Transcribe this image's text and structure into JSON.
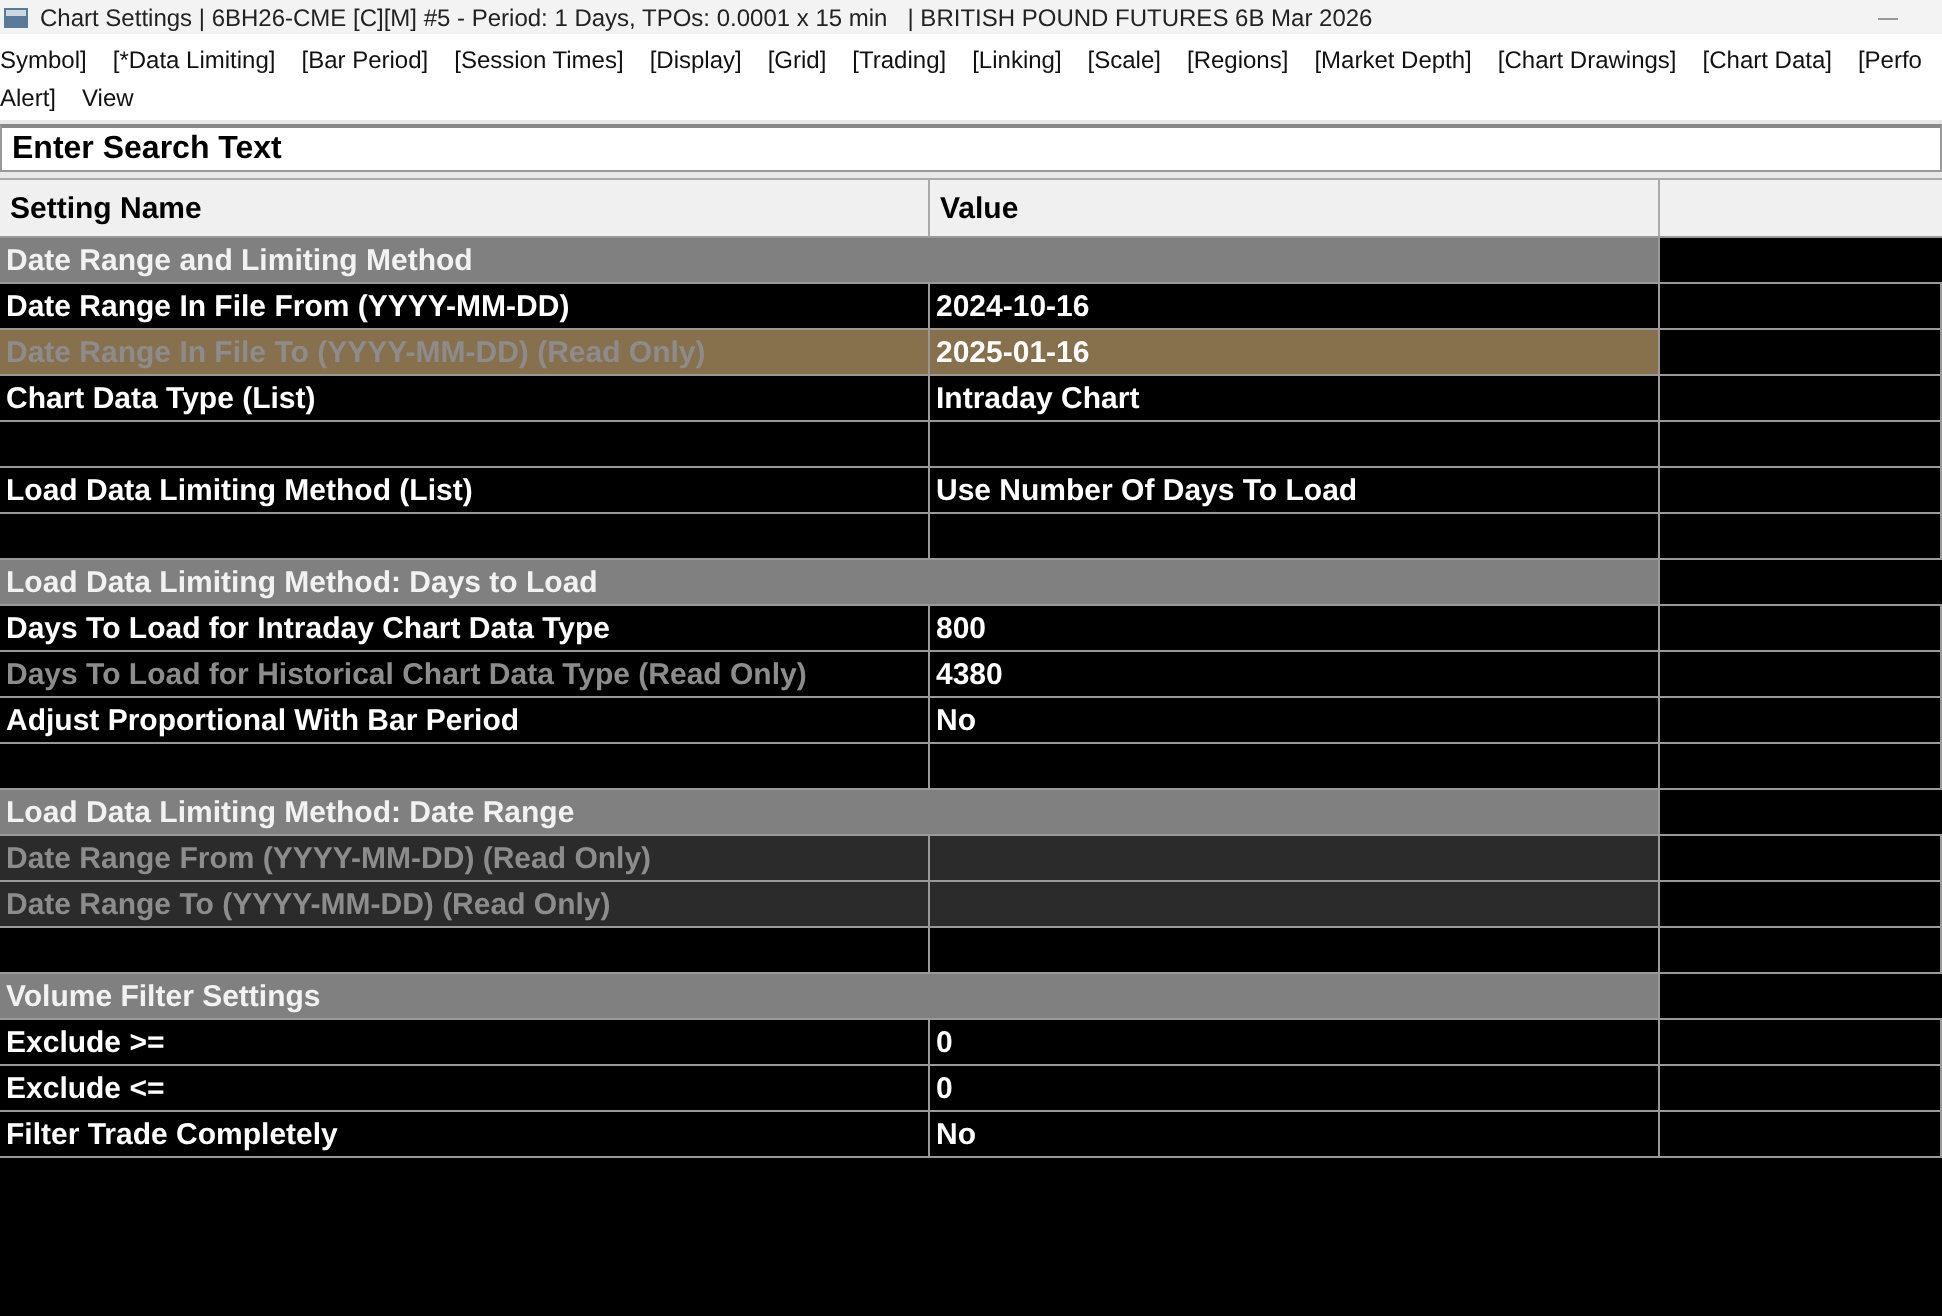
{
  "window": {
    "title": "Chart Settings | 6BH26-CME [C][M] #5 - Period: 1 Days, TPOs: 0.0001 x 15 min   | BRITISH POUND FUTURES 6B Mar 2026"
  },
  "tab_lines": [
    [
      "Symbol]",
      "[*Data Limiting]",
      "[Bar Period]",
      "[Session Times]",
      "[Display]",
      "[Grid]",
      "[Trading]",
      "[Linking]",
      "[Scale]",
      "[Regions]",
      "[Market Depth]",
      "[Chart Drawings]",
      "[Chart Data]",
      "[Perfo"
    ],
    [
      "Alert]",
      "View"
    ]
  ],
  "search": {
    "placeholder": "Enter Search Text"
  },
  "table": {
    "columns": [
      "Setting Name",
      "Value"
    ],
    "rows": [
      {
        "kind": "section",
        "name": "Date Range and Limiting Method"
      },
      {
        "kind": "setting",
        "name": "Date Range In File From (YYYY-MM-DD)",
        "value": "2024-10-16",
        "read_only": false,
        "disabled": false,
        "selected": false
      },
      {
        "kind": "setting",
        "name": "Date Range In File To (YYYY-MM-DD) (Read Only)",
        "value": "2025-01-16",
        "read_only": true,
        "disabled": false,
        "selected": true
      },
      {
        "kind": "setting",
        "name": "Chart Data Type (List)",
        "value": "Intraday Chart",
        "read_only": false,
        "disabled": false,
        "selected": false
      },
      {
        "kind": "blank"
      },
      {
        "kind": "setting",
        "name": "Load Data Limiting Method (List)",
        "value": "Use Number Of Days To Load",
        "read_only": false,
        "disabled": false,
        "selected": false
      },
      {
        "kind": "blank"
      },
      {
        "kind": "section",
        "name": "Load Data Limiting Method: Days to Load"
      },
      {
        "kind": "setting",
        "name": "Days To Load for Intraday Chart Data Type",
        "value": "800",
        "read_only": false,
        "disabled": false,
        "selected": false
      },
      {
        "kind": "setting",
        "name": "Days To Load for Historical Chart Data Type (Read Only)",
        "value": "4380",
        "read_only": true,
        "disabled": false,
        "selected": false
      },
      {
        "kind": "setting",
        "name": "Adjust Proportional With Bar Period",
        "value": "No",
        "read_only": false,
        "disabled": false,
        "selected": false
      },
      {
        "kind": "blank"
      },
      {
        "kind": "section",
        "name": "Load Data Limiting Method: Date Range"
      },
      {
        "kind": "setting",
        "name": "Date Range From (YYYY-MM-DD) (Read Only)",
        "read_only": true,
        "disabled": true,
        "selected": false
      },
      {
        "kind": "setting",
        "name": "Date Range To (YYYY-MM-DD) (Read Only)",
        "read_only": true,
        "disabled": true,
        "selected": false
      },
      {
        "kind": "blank"
      },
      {
        "kind": "section",
        "name": "Volume Filter Settings"
      },
      {
        "kind": "setting",
        "name": "Exclude >=",
        "value": "0",
        "read_only": false,
        "disabled": false,
        "selected": false
      },
      {
        "kind": "setting",
        "name": "Exclude <=",
        "value": "0",
        "read_only": false,
        "disabled": false,
        "selected": false
      },
      {
        "kind": "setting",
        "name": "Filter Trade Completely",
        "value": "No",
        "read_only": false,
        "disabled": false,
        "selected": false
      }
    ]
  }
}
